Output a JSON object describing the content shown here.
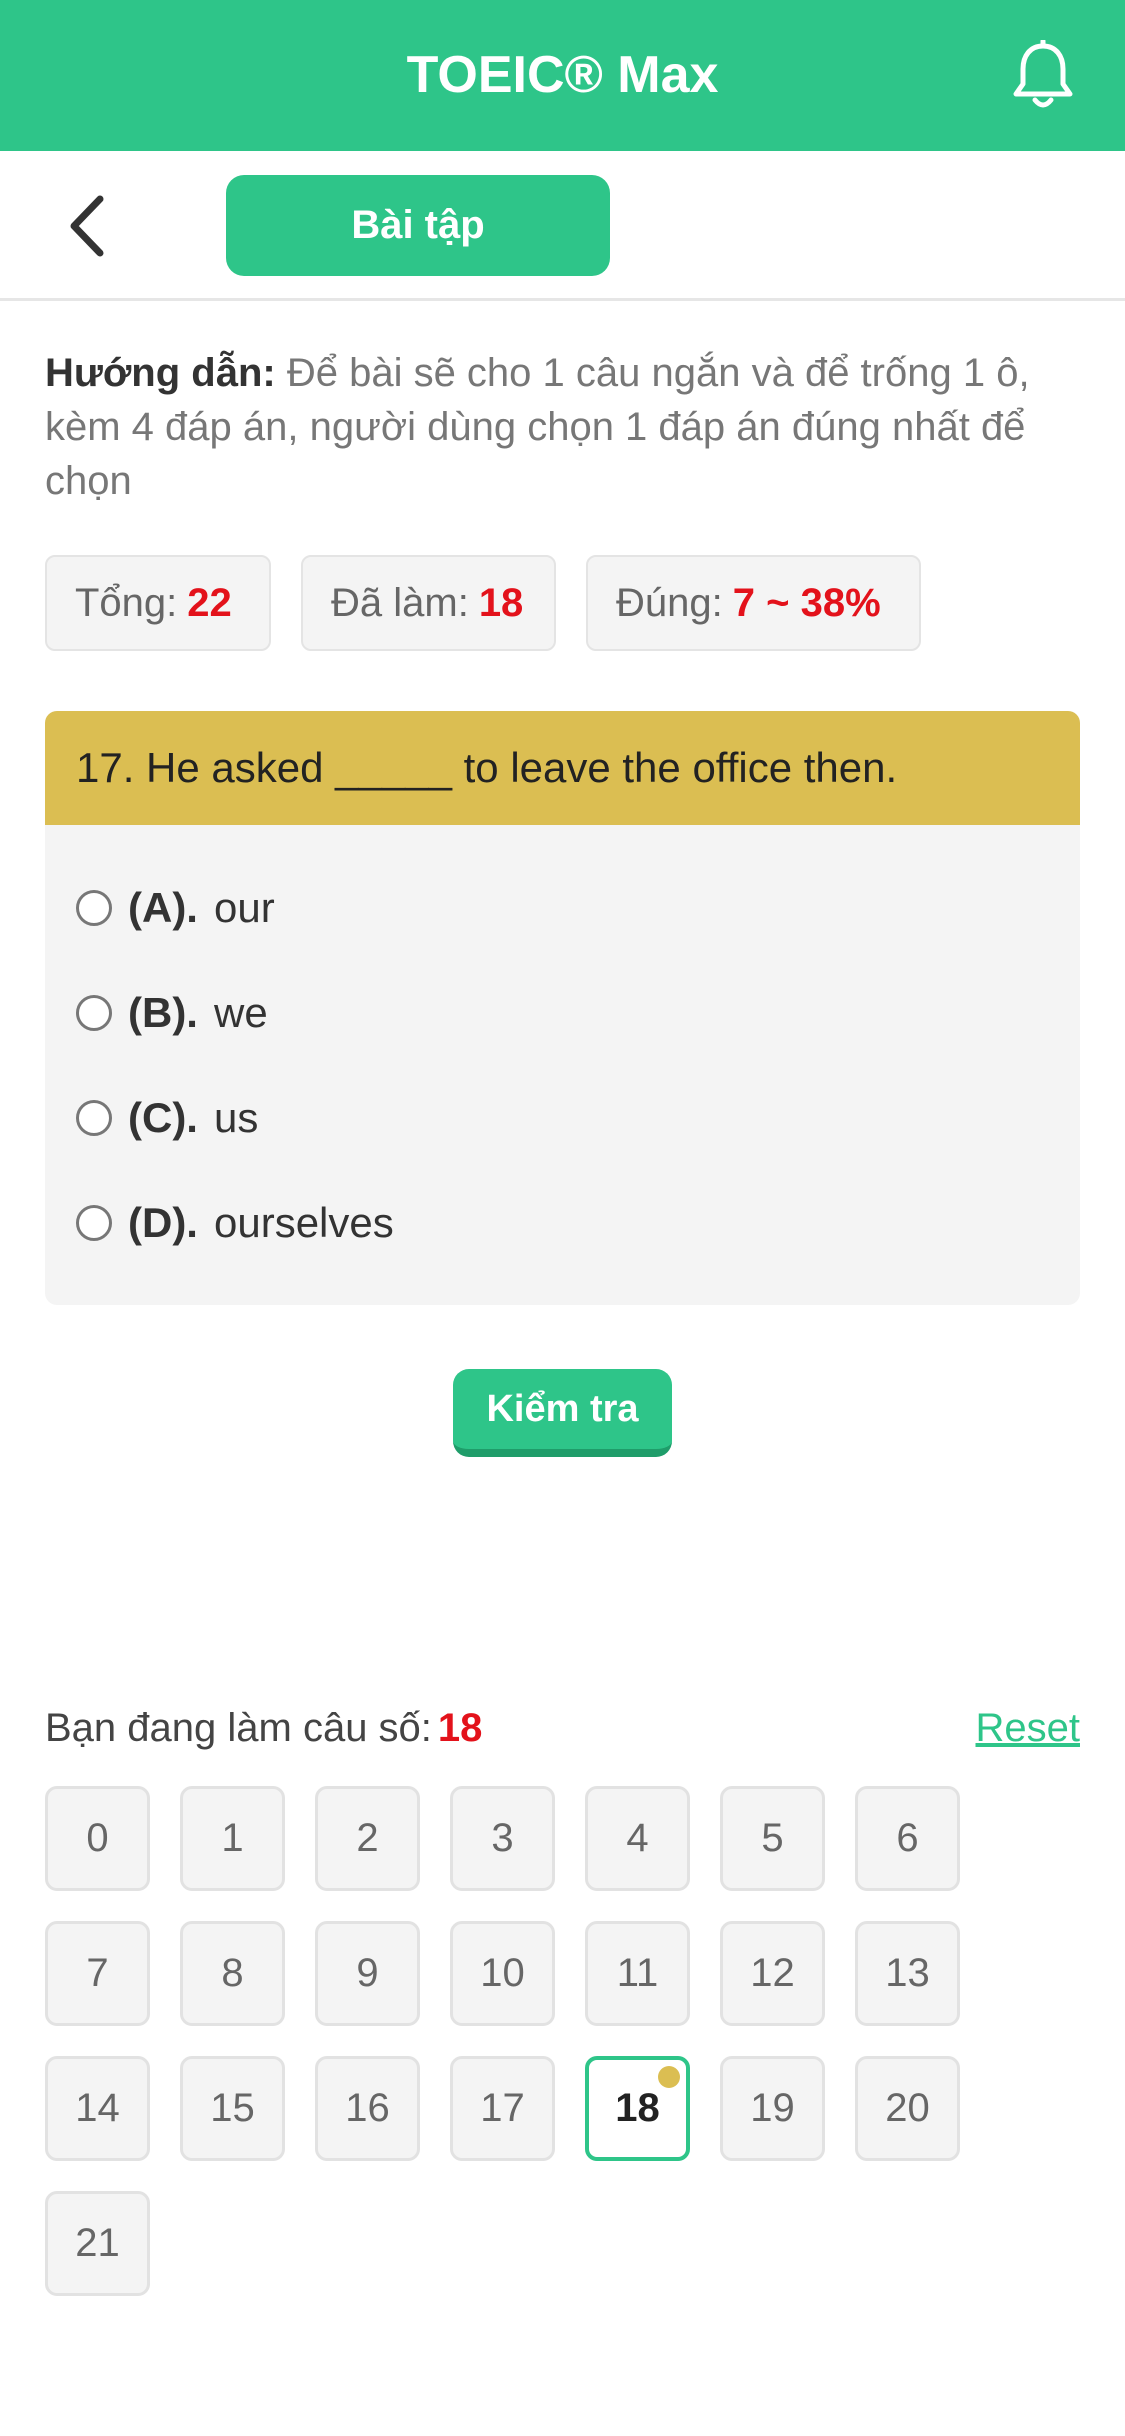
{
  "header": {
    "title": "TOEIC® Max"
  },
  "nav": {
    "tab_label": "Bài tập"
  },
  "guide": {
    "label": "Hướng dẫn:",
    "text": "Để bài sẽ cho 1 câu ngắn và để trống 1 ô, kèm 4 đáp án, người dùng chọn 1 đáp án đúng nhất để chọn"
  },
  "stats": {
    "total_label": "Tổng:",
    "total_value": "22",
    "done_label": "Đã làm:",
    "done_value": "18",
    "correct_label": "Đúng:",
    "correct_value": "7 ~ 38%"
  },
  "question": {
    "text": "17. He asked _____ to leave the office then.",
    "options": [
      {
        "key": "(A).",
        "text": "our"
      },
      {
        "key": "(B).",
        "text": "we"
      },
      {
        "key": "(C).",
        "text": "us"
      },
      {
        "key": "(D).",
        "text": "ourselves"
      }
    ]
  },
  "check_button": "Kiểm tra",
  "progress": {
    "label": "Bạn đang làm câu số:",
    "current": "18",
    "reset_label": "Reset"
  },
  "questions_grid": [
    "0",
    "1",
    "2",
    "3",
    "4",
    "5",
    "6",
    "7",
    "8",
    "9",
    "10",
    "11",
    "12",
    "13",
    "14",
    "15",
    "16",
    "17",
    "18",
    "19",
    "20",
    "21"
  ],
  "active_question": "18",
  "colors": {
    "primary": "#2ec589",
    "question_header": "#dbbe52",
    "highlight": "#e3121b"
  }
}
